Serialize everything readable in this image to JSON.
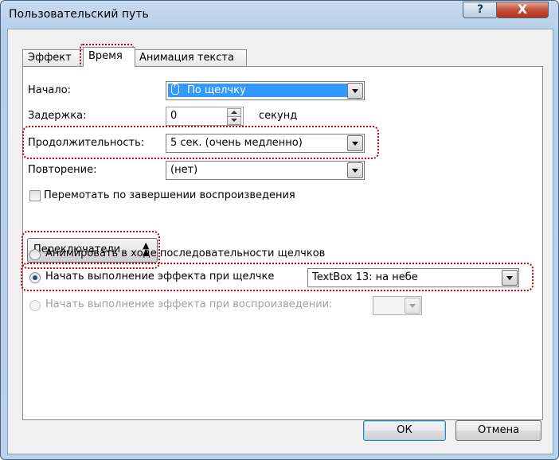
{
  "window": {
    "title": "Пользовательский путь",
    "help_label": "?",
    "close_label": "X"
  },
  "tabs": [
    {
      "label": "Эффект",
      "active": false
    },
    {
      "label": "Время",
      "active": true
    },
    {
      "label": "Анимация текста",
      "active": false
    }
  ],
  "timing": {
    "start_label": "Начало:",
    "start_value": "По щелчку",
    "start_icon": "mouse-icon",
    "delay_label": "Задержка:",
    "delay_value": "0",
    "delay_unit": "секунд",
    "duration_label": "Продолжительность:",
    "duration_value": "5 сек. (очень медленно)",
    "repeat_label": "Повторение:",
    "repeat_value": "(нет)",
    "rewind_label": "Перемотать по завершении воспроизведения",
    "rewind_checked": false
  },
  "triggers": {
    "button_label": "Переключатели",
    "button_icon": "chevron-up-double-icon",
    "option_animate_sequence": "Анимировать в ходе последовательности щелчков",
    "option_start_on_click": "Начать выполнение эффекта при щелчке",
    "start_on_click_target": "TextBox 13: на небе",
    "option_start_on_play": "Начать выполнение эффекта при воспроизведении:",
    "start_on_play_value": "",
    "selected_option": "start_on_click"
  },
  "footer": {
    "ok_label": "ОК",
    "cancel_label": "Отмена"
  },
  "colors": {
    "highlight_outline": "#c00000",
    "selection": "#3399ff",
    "close_button": "#c45038"
  }
}
